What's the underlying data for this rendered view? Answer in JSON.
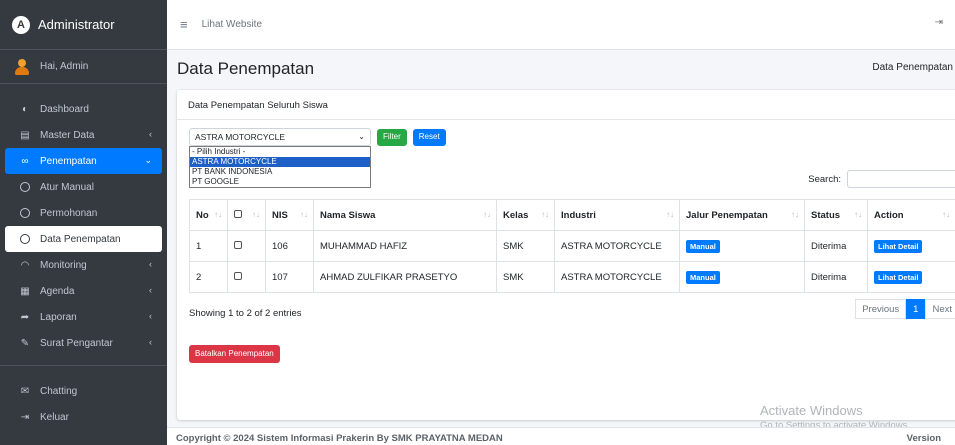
{
  "sidebar": {
    "brand": "Administrator",
    "brand_logo": "A",
    "user": "Hai, Admin",
    "items": [
      {
        "label": "Dashboard",
        "icon": "dashboard-icon",
        "glyph": "◐"
      },
      {
        "label": "Master Data",
        "icon": "database-icon",
        "glyph": "▤"
      },
      {
        "label": "Penempatan",
        "icon": "link-icon",
        "glyph": "∞"
      },
      {
        "label": "Atur Manual",
        "icon": "circle-icon"
      },
      {
        "label": "Permohonan",
        "icon": "circle-icon"
      },
      {
        "label": "Data Penempatan",
        "icon": "circle-icon"
      },
      {
        "label": "Monitoring",
        "icon": "signal-icon",
        "glyph": "◠"
      },
      {
        "label": "Agenda",
        "icon": "calendar-icon",
        "glyph": "▦"
      },
      {
        "label": "Laporan",
        "icon": "report-icon",
        "glyph": "➦"
      },
      {
        "label": "Surat Pengantar",
        "icon": "letter-icon",
        "glyph": "✎"
      },
      {
        "label": "Chatting",
        "icon": "envelope-icon",
        "glyph": "✉"
      },
      {
        "label": "Keluar",
        "icon": "logout-icon",
        "glyph": "⇥"
      }
    ]
  },
  "topbar": {
    "link": "Lihat Website"
  },
  "page": {
    "title": "Data Penempatan",
    "breadcrumb": "Data Penempatan",
    "card_title": "Data Penempatan Seluruh Siswa"
  },
  "filter": {
    "selected": "ASTRA MOTORCYCLE",
    "options": [
      "- Pilih Industri -",
      "ASTRA MOTORCYCLE",
      "PT BANK INDONESIA",
      "PT GOOGLE"
    ],
    "filter_label": "Filter",
    "reset_label": "Reset"
  },
  "search": {
    "label": "Search:"
  },
  "table": {
    "headers": [
      "No",
      "",
      "NIS",
      "Nama Siswa",
      "Kelas",
      "Industri",
      "Jalur Penempatan",
      "Status",
      "Action"
    ],
    "rows": [
      {
        "no": "1",
        "nis": "106",
        "nama": "MUHAMMAD HAFIZ",
        "kelas": "SMK",
        "industri": "ASTRA MOTORCYCLE",
        "jalur": "Manual",
        "status": "Diterima",
        "action": "Lihat Detail"
      },
      {
        "no": "2",
        "nis": "107",
        "nama": "AHMAD ZULFIKAR PRASETYO",
        "kelas": "SMK",
        "industri": "ASTRA MOTORCYCLE",
        "jalur": "Manual",
        "status": "Diterima",
        "action": "Lihat Detail"
      }
    ]
  },
  "pagination": {
    "info": "Showing 1 to 2 of 2 entries",
    "previous": "Previous",
    "current": "1",
    "next": "Next"
  },
  "cancel_button": "Batalkan Penempatan",
  "footer": {
    "copyright": "Copyright © 2024 Sistem Informasi Prakerin By SMK PRAYATNA MEDAN",
    "version": "Version"
  },
  "watermark": {
    "title": "Activate Windows",
    "subtitle": "Go to Settings to activate Windows."
  },
  "colors": {
    "primary": "#007bff",
    "success": "#28a745",
    "danger": "#dc3545",
    "sidebar": "#343a40"
  }
}
